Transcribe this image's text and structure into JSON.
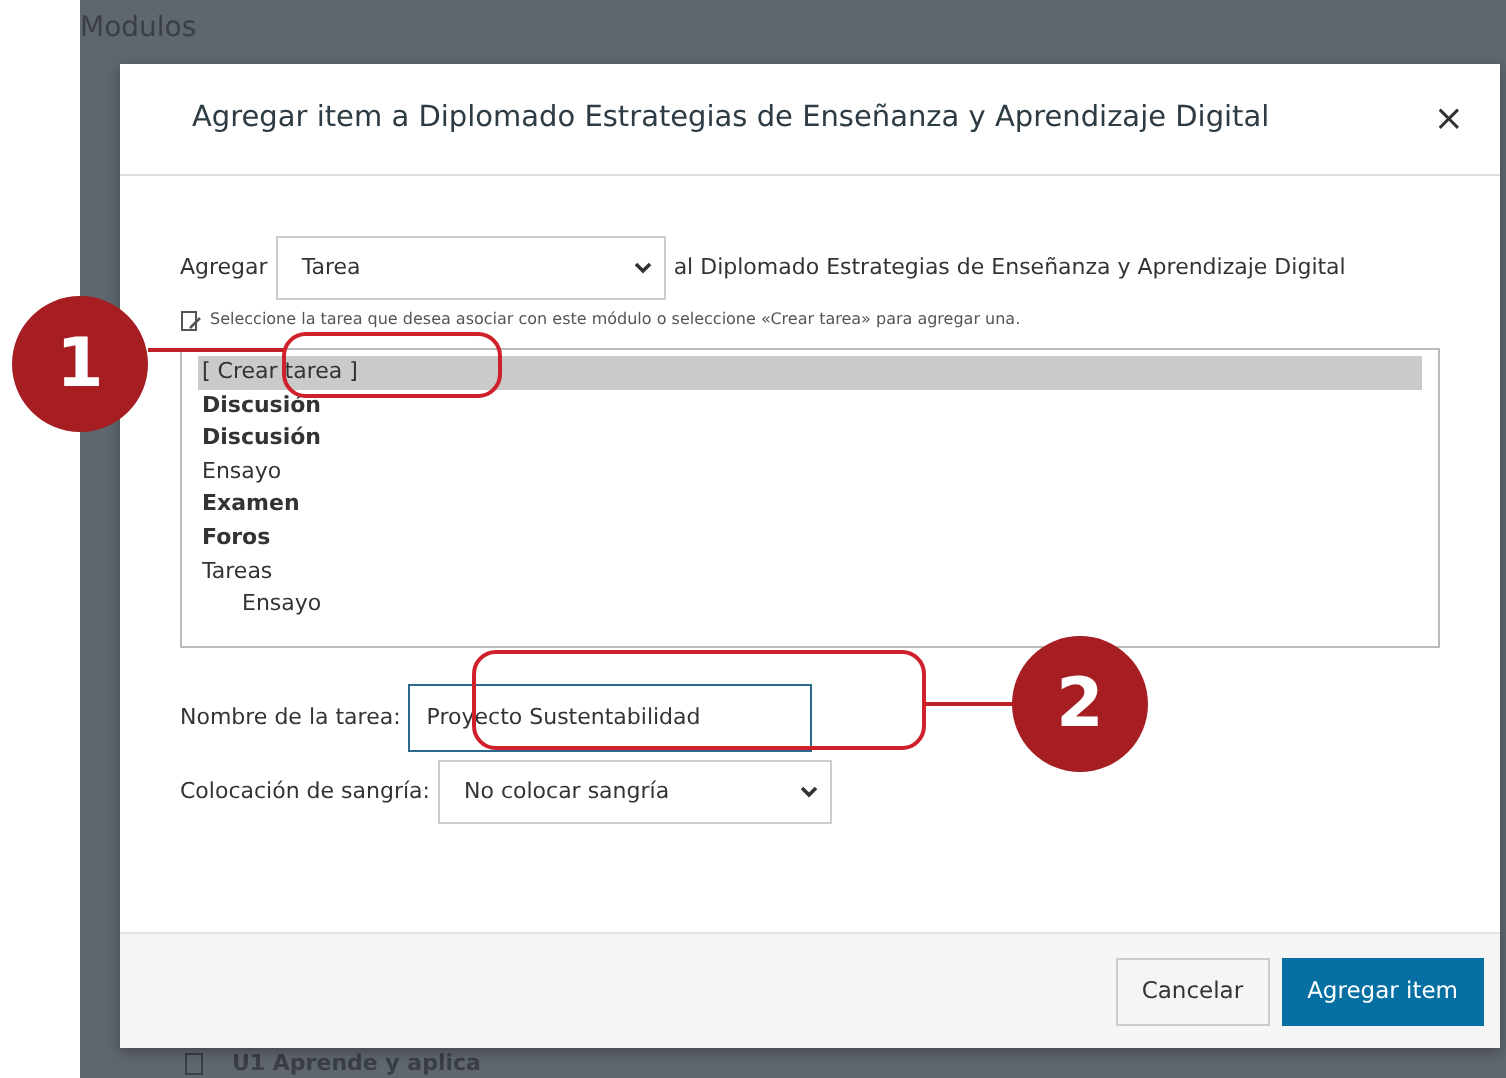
{
  "background": {
    "heading": "Modulos",
    "module_item": "U1 Aprende y aplica"
  },
  "modal": {
    "title": "Agregar item a Diplomado Estrategias de Enseñanza y Aprendizaje Digital",
    "close": "×",
    "add_label": "Agregar",
    "add_type": "Tarea",
    "add_target": "al Diplomado Estrategias de Enseñanza y Aprendizaje Digital",
    "hint": "Seleccione la tarea que desea asociar con este módulo o seleccione «Crear tarea» para agregar una.",
    "items": [
      {
        "label": "[ Crear tarea ]",
        "bold": false,
        "selected": true
      },
      {
        "label": "Discusión",
        "bold": true,
        "selected": false
      },
      {
        "label": "Discusión",
        "bold": true,
        "selected": false
      },
      {
        "label": "Ensayo",
        "bold": false,
        "selected": false
      },
      {
        "label": "Examen",
        "bold": true,
        "selected": false
      },
      {
        "label": "Foros",
        "bold": true,
        "selected": false
      },
      {
        "label": "Tareas",
        "bold": false,
        "selected": false,
        "children": [
          {
            "label": "Ensayo",
            "bold": false,
            "selected": false
          }
        ]
      }
    ],
    "name_label": "Nombre de la tarea:",
    "name_value": "Proyecto Sustentabilidad",
    "indent_label": "Colocación de sangría:",
    "indent_value": "No colocar sangría",
    "buttons": [
      {
        "label": "Cancelar",
        "kind": "secondary"
      },
      {
        "label": "Agregar item",
        "kind": "primary"
      }
    ]
  },
  "callouts": [
    {
      "number": "1"
    },
    {
      "number": "2"
    }
  ]
}
